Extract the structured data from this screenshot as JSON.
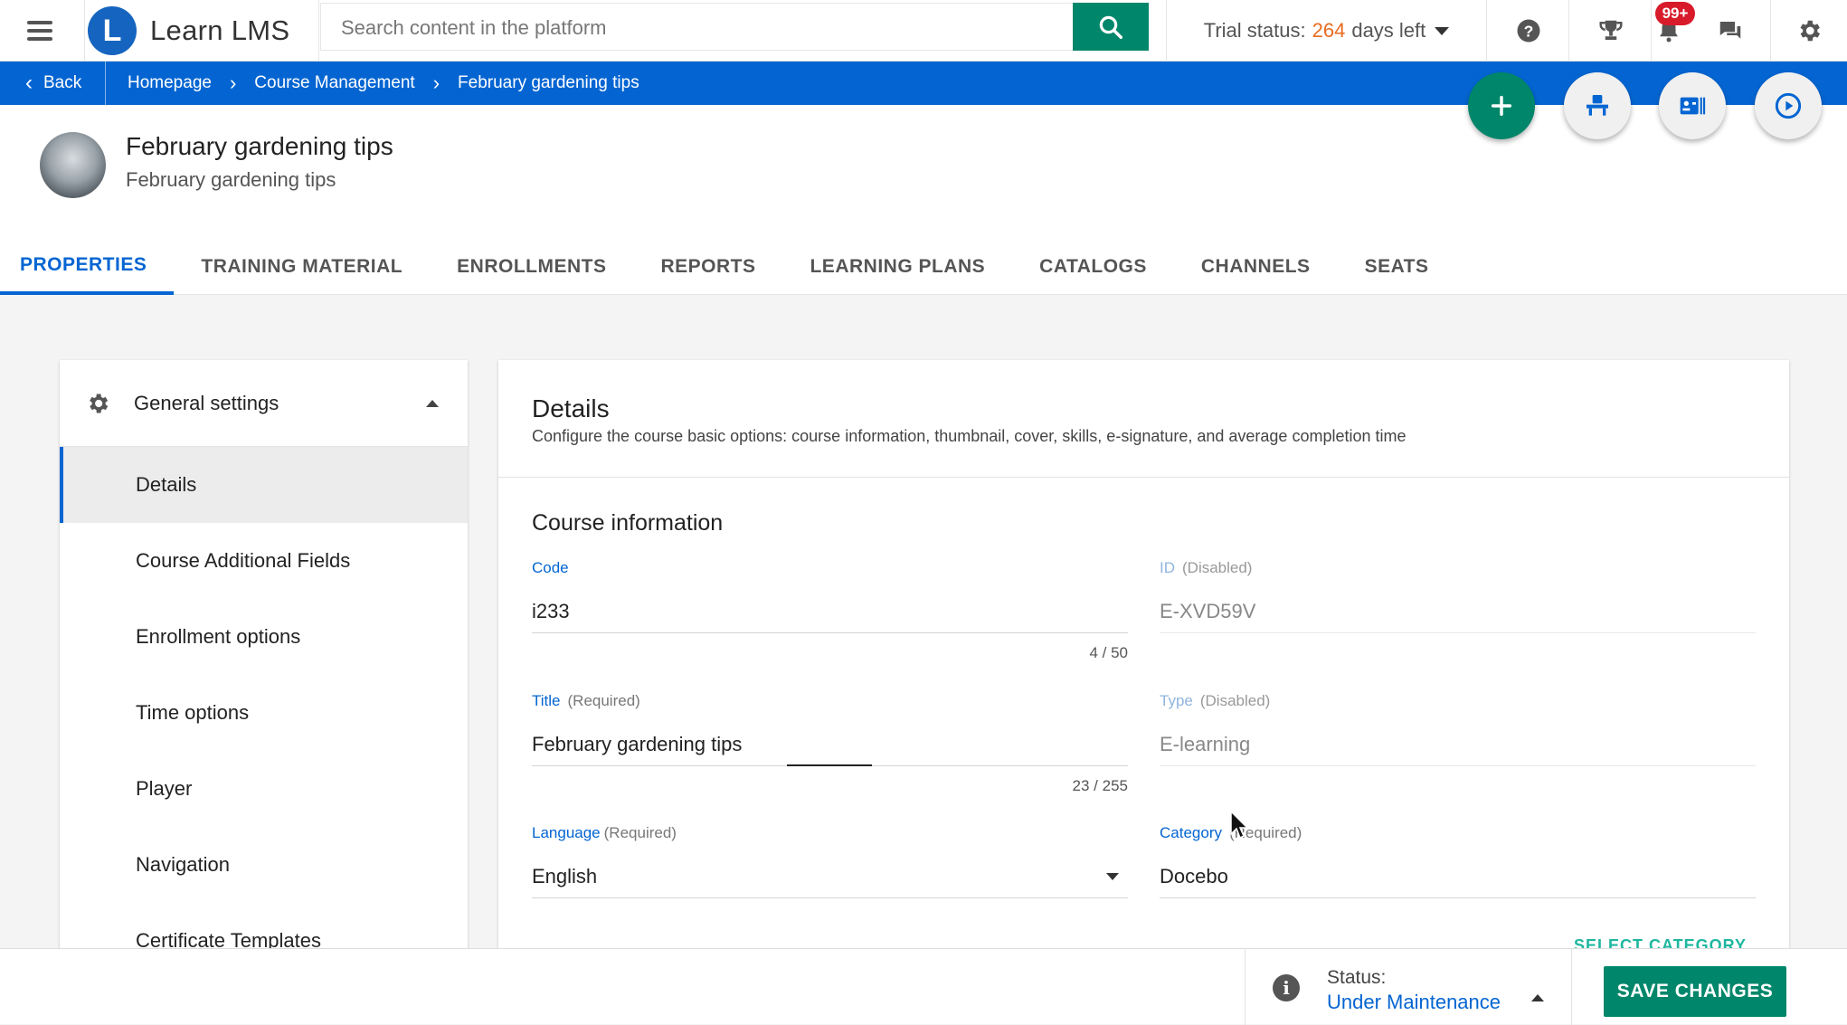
{
  "app": {
    "brand_name": "Learn LMS",
    "brand_initial": "L",
    "accent_color": "#0465d2",
    "primary_button_color": "#00866a"
  },
  "topbar": {
    "search_placeholder": "Search content in the platform",
    "trial_prefix": "Trial status:",
    "trial_days": "264",
    "trial_suffix": "days left",
    "notification_count": "99+",
    "icons": [
      "menu-icon",
      "search-icon",
      "help-icon",
      "trophy-icon",
      "bell-icon",
      "chat-icon",
      "gear-icon"
    ]
  },
  "breadcrumb": {
    "back_label": "Back",
    "items": [
      "Homepage",
      "Course Management",
      "February gardening tips"
    ]
  },
  "actions": {
    "icons": [
      "plus-icon",
      "classroom-icon",
      "badge-card-icon",
      "play-icon"
    ]
  },
  "course": {
    "title": "February gardening tips",
    "subtitle": "February gardening tips"
  },
  "tabs": [
    "PROPERTIES",
    "TRAINING MATERIAL",
    "ENROLLMENTS",
    "REPORTS",
    "LEARNING PLANS",
    "CATALOGS",
    "CHANNELS",
    "SEATS"
  ],
  "sidebar": {
    "section": "General settings",
    "items": [
      "Details",
      "Course Additional Fields",
      "Enrollment options",
      "Time options",
      "Player",
      "Navigation",
      "Certificate Templates"
    ]
  },
  "details": {
    "title": "Details",
    "description": "Configure the course basic options: course information, thumbnail, cover, skills, e-signature, and average completion time",
    "section": "Course information",
    "code": {
      "label": "Code",
      "value": "i233",
      "counter": "4 / 50"
    },
    "id": {
      "label": "ID",
      "note": "(Disabled)",
      "value": "E-XVD59V"
    },
    "title_field": {
      "label": "Title",
      "note": "(Required)",
      "value": "February gardening tips",
      "counter": "23 / 255"
    },
    "type": {
      "label": "Type",
      "note": "(Disabled)",
      "value": "E-learning"
    },
    "language": {
      "label": "Language",
      "note": "(Required)",
      "value": "English"
    },
    "category": {
      "label": "Category",
      "note": "(Required)",
      "value": "Docebo"
    },
    "cut_off_link": "SELECT CATEGORY"
  },
  "footer": {
    "status_label": "Status:",
    "status_value": "Under Maintenance",
    "save_label": "SAVE CHANGES"
  }
}
